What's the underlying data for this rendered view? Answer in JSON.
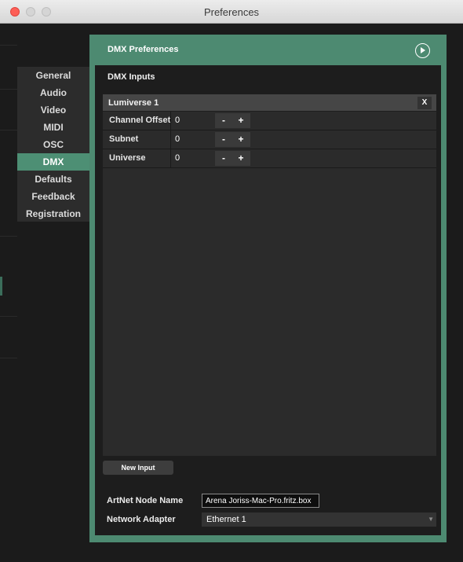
{
  "window": {
    "title": "Preferences"
  },
  "sidebar": {
    "items": [
      {
        "label": "General"
      },
      {
        "label": "Audio"
      },
      {
        "label": "Video"
      },
      {
        "label": "MIDI"
      },
      {
        "label": "OSC"
      },
      {
        "label": "DMX",
        "active": true
      },
      {
        "label": "Defaults"
      },
      {
        "label": "Feedback"
      },
      {
        "label": "Registration"
      }
    ]
  },
  "panel": {
    "title": "DMX Preferences",
    "section_title": "DMX Inputs",
    "input": {
      "name": "Lumiverse 1",
      "remove_label": "X",
      "params": [
        {
          "label": "Channel Offset",
          "value": "0",
          "minus": "-",
          "plus": "+"
        },
        {
          "label": "Subnet",
          "value": "0",
          "minus": "-",
          "plus": "+"
        },
        {
          "label": "Universe",
          "value": "0",
          "minus": "-",
          "plus": "+"
        }
      ]
    },
    "new_input_label": "New Input",
    "artnet_label": "ArtNet Node Name",
    "artnet_value": "Arena Joriss-Mac-Pro.fritz.box",
    "adapter_label": "Network Adapter",
    "adapter_value": "Ethernet 1"
  },
  "icons": {
    "panel_action": "play-circle-icon",
    "dropdown": "chevron-down-icon"
  },
  "colors": {
    "accent": "#4d8a71",
    "active_nav": "#4d8f74",
    "close": "#fd5f57"
  }
}
